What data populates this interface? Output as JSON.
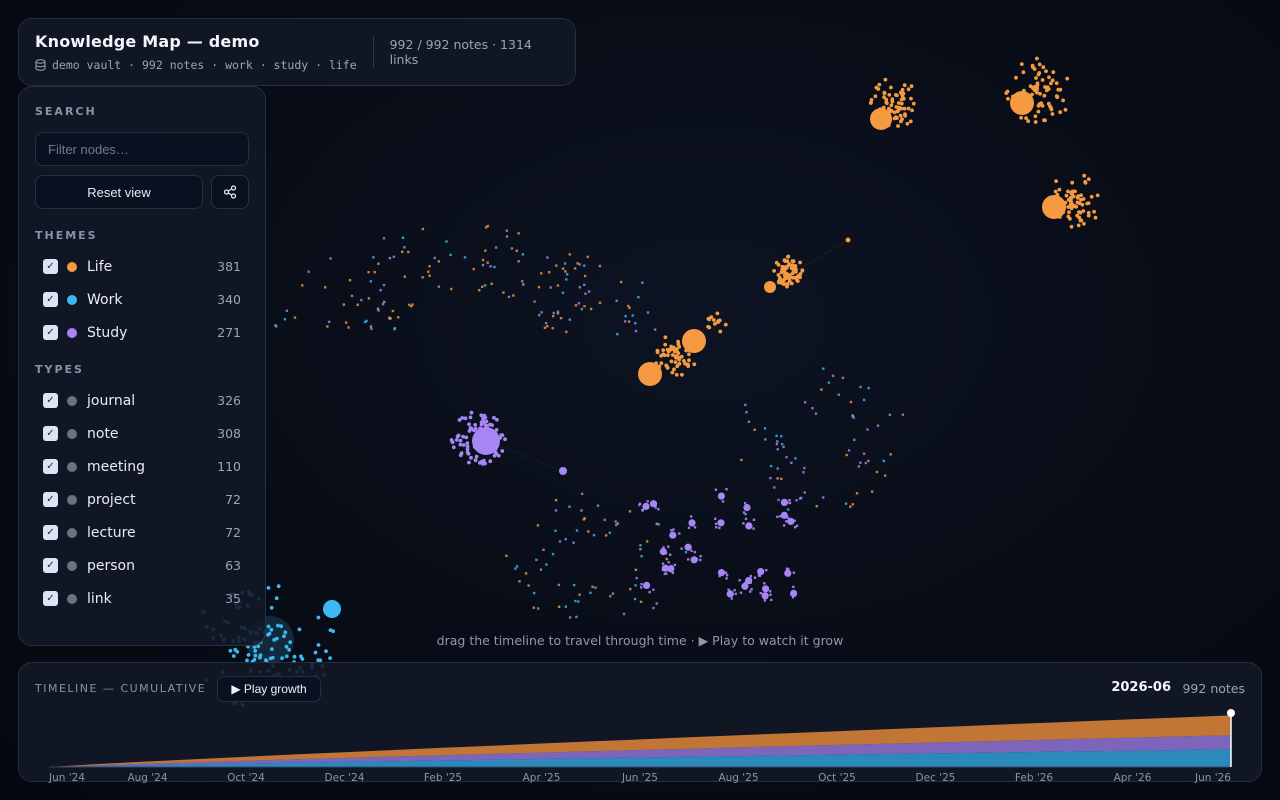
{
  "header": {
    "title": "Knowledge Map — demo",
    "subtitle_icon": "database-icon",
    "subtitle": "demo vault · 992 notes · work · study · life",
    "stats": "992 / 992 notes · 1314 links"
  },
  "search": {
    "label": "SEARCH",
    "placeholder": "Filter nodes…",
    "reset_label": "Reset view",
    "share_icon": "share-icon"
  },
  "themes": {
    "label": "THEMES",
    "items": [
      {
        "name": "Life",
        "count": "381",
        "color": "#f59a40",
        "checked": true
      },
      {
        "name": "Work",
        "count": "340",
        "color": "#3db8f5",
        "checked": true
      },
      {
        "name": "Study",
        "count": "271",
        "color": "#a686f5",
        "checked": true
      }
    ]
  },
  "types": {
    "label": "TYPES",
    "items": [
      {
        "name": "journal",
        "count": "326",
        "color": "#6b7280",
        "checked": true
      },
      {
        "name": "note",
        "count": "308",
        "color": "#6b7280",
        "checked": true
      },
      {
        "name": "meeting",
        "count": "110",
        "color": "#6b7280",
        "checked": true
      },
      {
        "name": "project",
        "count": "72",
        "color": "#6b7280",
        "checked": true
      },
      {
        "name": "lecture",
        "count": "72",
        "color": "#6b7280",
        "checked": true
      },
      {
        "name": "person",
        "count": "63",
        "color": "#6b7280",
        "checked": true
      },
      {
        "name": "link",
        "count": "35",
        "color": "#6b7280",
        "checked": true
      }
    ]
  },
  "hint": "drag the timeline to travel through time · ▶ Play to watch it grow",
  "timeline": {
    "label": "TIMELINE — CUMULATIVE",
    "play_label": "▶ Play growth",
    "current_date": "2026-06",
    "current_count": "992 notes",
    "ticks": [
      "Jun '24",
      "Aug '24",
      "Oct '24",
      "Dec '24",
      "Feb '25",
      "Apr '25",
      "Jun '25",
      "Aug '25",
      "Oct '25",
      "Dec '25",
      "Feb '26",
      "Apr '26",
      "Jun '26"
    ],
    "series_colors": {
      "life": "#e0873a",
      "study": "#8f73d6",
      "work": "#2f9fd6"
    },
    "final_totals": {
      "life": 381,
      "study": 271,
      "work": 340
    }
  },
  "colors": {
    "life": "#f59a40",
    "work": "#3db8f5",
    "study": "#a686f5"
  }
}
